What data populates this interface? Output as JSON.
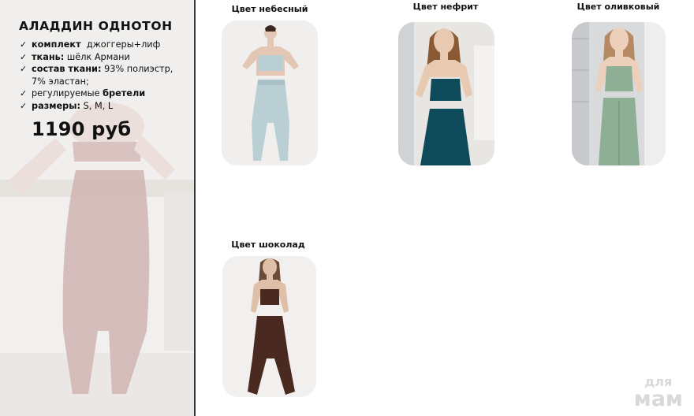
{
  "product": {
    "title": "АЛАДДИН  ОДНОТОН",
    "specs": [
      {
        "label": "комплект",
        "value": "джоггеры+лиф"
      },
      {
        "label": "ткань:",
        "value": "шёлк Армани"
      },
      {
        "label": "состав ткани:",
        "value": "93% полиэстр, 7% эластан;"
      },
      {
        "label": "регулируемые",
        "value": "бретели"
      },
      {
        "label": "размеры:",
        "value": "S, M, L"
      }
    ],
    "price": "1190 руб"
  },
  "colors": [
    {
      "label": "Цвет небесный",
      "swatch": "#b9cfd4"
    },
    {
      "label": "Цвет нефрит",
      "swatch": "#0f4a5a"
    },
    {
      "label": "Цвет оливковый",
      "swatch": "#8fae96"
    },
    {
      "label": "Цвет шоколад",
      "swatch": "#4a2a20"
    }
  ],
  "watermark": {
    "line1": "для",
    "line2": "мам"
  }
}
